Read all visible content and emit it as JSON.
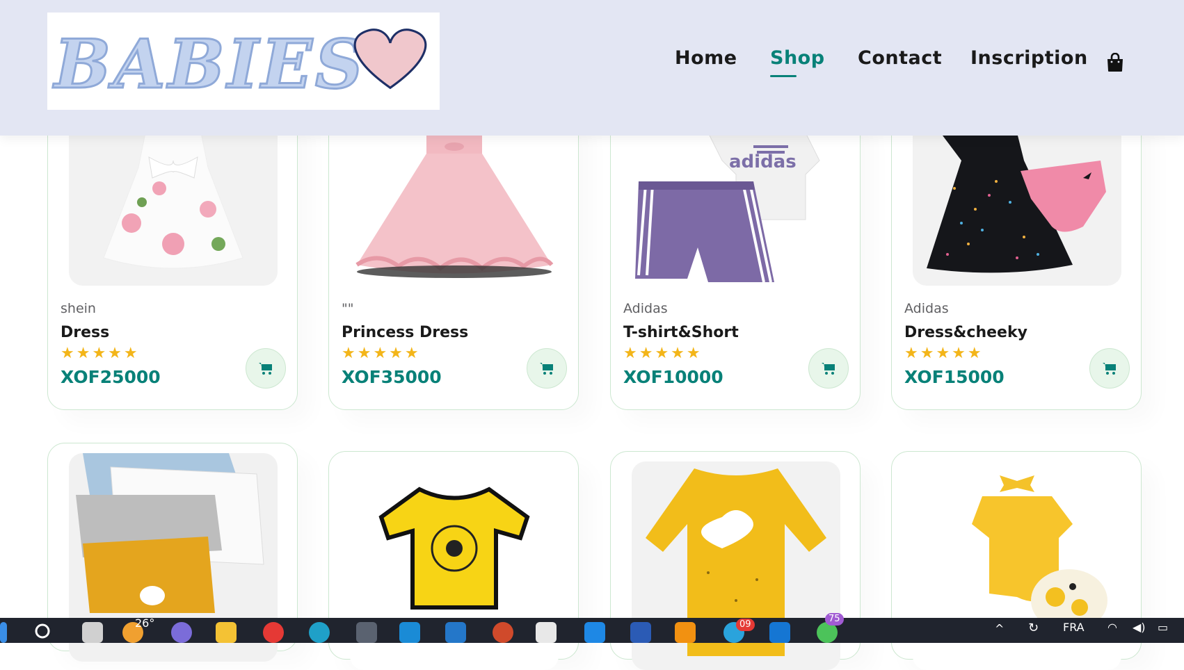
{
  "header": {
    "logo_alt": "BABIES",
    "nav": [
      {
        "label": "Home"
      },
      {
        "label": "Shop"
      },
      {
        "label": "Contact"
      },
      {
        "label": "Inscription"
      }
    ],
    "active_nav": "Shop",
    "accent_color": "#088178",
    "header_bg": "#e3e6f3",
    "bag_icon": "shopping-bag-icon"
  },
  "products": [
    {
      "brand": "shein",
      "name": "Dress",
      "stars": "★★★★★",
      "rating": 5,
      "price": "XOF25000"
    },
    {
      "brand": "\"\"",
      "name": "Princess Dress",
      "stars": "★★★★★",
      "rating": 5,
      "price": "XOF35000"
    },
    {
      "brand": "Adidas",
      "name": "T-shirt&Short",
      "stars": "★★★★★",
      "rating": 5,
      "price": "XOF10000"
    },
    {
      "brand": "Adidas",
      "name": "Dress&cheeky",
      "stars": "★★★★★",
      "rating": 5,
      "price": "XOF15000"
    }
  ],
  "products_row2": [
    {
      "image": "baby-bodysuits-stack"
    },
    {
      "image": "yellow-onesie"
    },
    {
      "image": "yellow-heart-romper"
    },
    {
      "image": "yellow-ruffle-set"
    }
  ],
  "taskbar": {
    "weather": "26°",
    "telegram_badge": "09",
    "whatsapp_badge": "75",
    "language": "FRA"
  }
}
